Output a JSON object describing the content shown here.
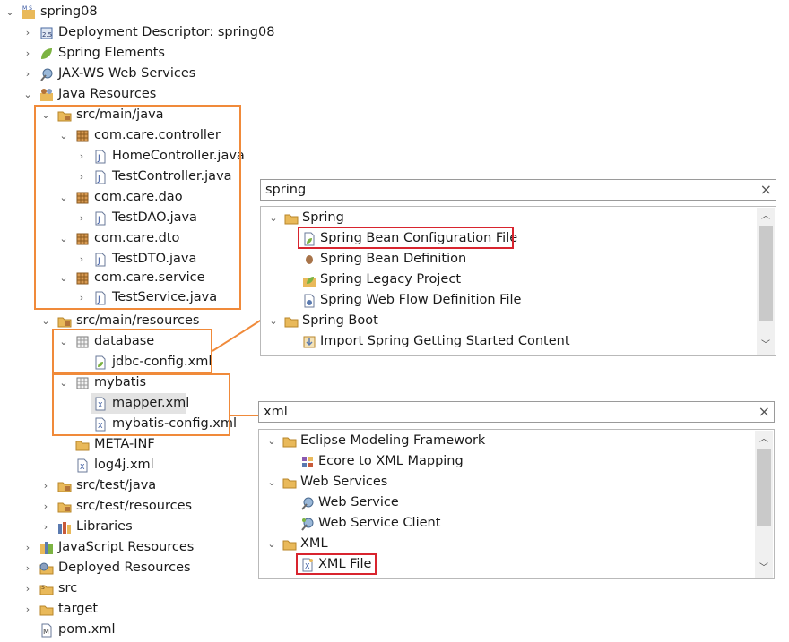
{
  "tree": {
    "project": "spring08",
    "deployment_descriptor": "Deployment Descriptor: spring08",
    "spring_elements": "Spring Elements",
    "jaxws": "JAX-WS Web Services",
    "java_resources": "Java Resources",
    "src_main_java": "src/main/java",
    "pkg_controller": "com.care.controller",
    "home_controller": "HomeController.java",
    "test_controller": "TestController.java",
    "pkg_dao": "com.care.dao",
    "test_dao": "TestDAO.java",
    "pkg_dto": "com.care.dto",
    "test_dto": "TestDTO.java",
    "pkg_service": "com.care.service",
    "test_service": "TestService.java",
    "src_main_resources": "src/main/resources",
    "database": "database",
    "jdbc_config": "jdbc-config.xml",
    "mybatis": "mybatis",
    "mapper": "mapper.xml",
    "mybatis_config": "mybatis-config.xml",
    "meta_inf": "META-INF",
    "log4j": "log4j.xml",
    "src_test_java": "src/test/java",
    "src_test_resources": "src/test/resources",
    "libraries": "Libraries",
    "js_resources": "JavaScript Resources",
    "deployed_resources": "Deployed Resources",
    "src": "src",
    "target": "target",
    "pom": "pom.xml"
  },
  "wizard_spring": {
    "filter": "spring",
    "cat_spring": "Spring",
    "bean_config": "Spring Bean Configuration File",
    "bean_def": "Spring Bean Definition",
    "legacy": "Spring Legacy Project",
    "webflow": "Spring Web Flow Definition File",
    "cat_boot": "Spring Boot",
    "import_getting_started": "Import Spring Getting Started Content"
  },
  "wizard_xml": {
    "filter": "xml",
    "cat_emf": "Eclipse Modeling Framework",
    "ecore_xml": "Ecore to XML Mapping",
    "cat_ws": "Web Services",
    "web_service": "Web Service",
    "web_service_client": "Web Service Client",
    "cat_xml": "XML",
    "xml_file": "XML File"
  },
  "colors": {
    "highlight_orange": "#f08a3a",
    "highlight_red": "#d8242e",
    "folder": "#e9b95a",
    "package": "#b3743a"
  },
  "icons": {
    "clear": "×",
    "expanded": "⌄",
    "collapsed": "›",
    "scroll_up": "︿",
    "scroll_down": "﹀"
  }
}
